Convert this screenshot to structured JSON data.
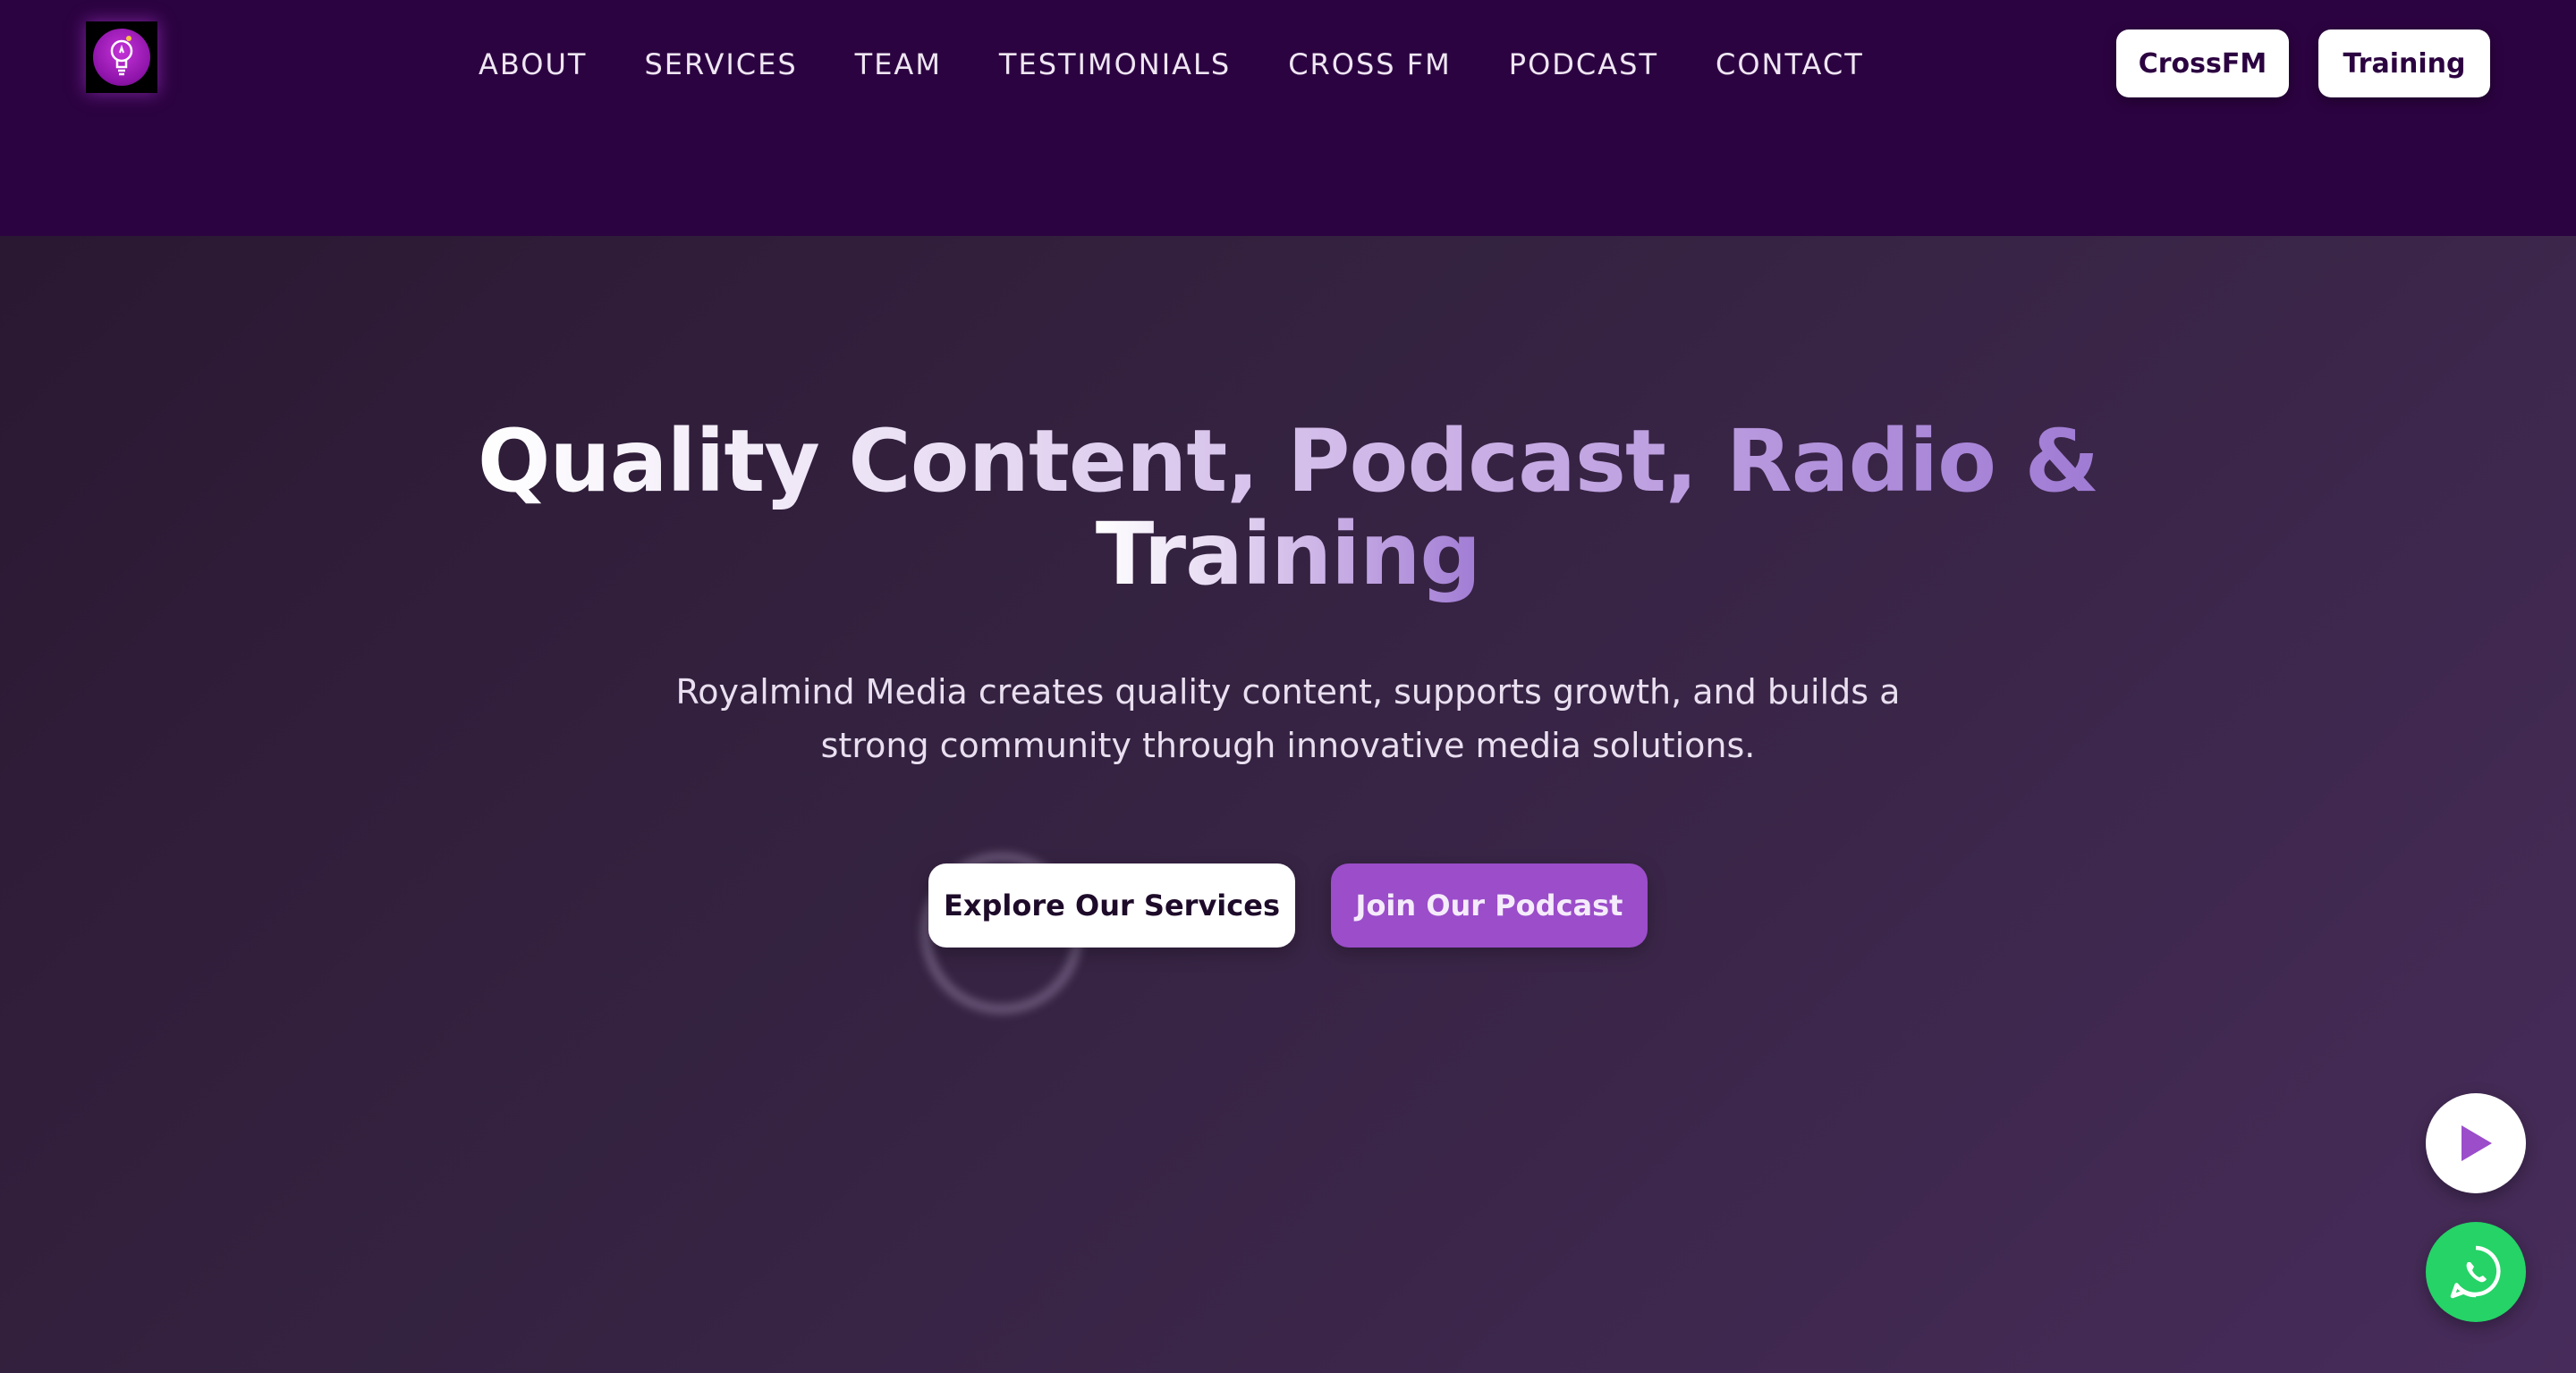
{
  "header": {
    "logo": "lightbulb-logo",
    "nav": [
      {
        "label": "ABOUT"
      },
      {
        "label": "SERVICES"
      },
      {
        "label": "TEAM"
      },
      {
        "label": "TESTIMONIALS"
      },
      {
        "label": "CROSS FM"
      },
      {
        "label": "PODCAST"
      },
      {
        "label": "CONTACT"
      }
    ],
    "buttons": {
      "crossfm": "CrossFM",
      "training": "Training"
    }
  },
  "hero": {
    "title_line1": "Quality Content, Podcast, Radio &",
    "title_line2": "Training",
    "subtitle_line1": "Royalmind Media creates quality content, supports growth, and builds a",
    "subtitle_line2": "strong community through innovative media solutions.",
    "cta_primary": "Explore Our Services",
    "cta_secondary": "Join Our Podcast"
  },
  "floating": {
    "play_icon": "play-icon",
    "whatsapp_icon": "whatsapp-icon"
  },
  "colors": {
    "header_bg": "#2c0341",
    "accent": "#9b4dca",
    "whatsapp": "#25d366"
  }
}
